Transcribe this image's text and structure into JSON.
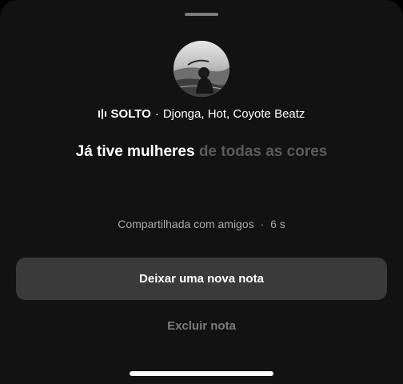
{
  "note": {
    "song": {
      "title": "SOLTO",
      "separator": "·",
      "artists": "Djonga, Hot, Coyote Beatz"
    },
    "lyric": {
      "active": "Já tive mulheres",
      "upcoming": "de todas as cores"
    },
    "meta": {
      "shared": "Compartilhada com amigos",
      "separator": "·",
      "age": "6 s"
    }
  },
  "actions": {
    "new_note_label": "Deixar uma nova nota",
    "delete_note_label": "Excluir nota"
  },
  "colors": {
    "sheet_background": "#121212",
    "primary_button": "#3a3a3a",
    "muted_text": "#a8a8a8",
    "upcoming_lyric": "#5a5a5a",
    "delete_text": "#7a7a7a"
  },
  "icons": {
    "music": "music-bars-icon"
  }
}
